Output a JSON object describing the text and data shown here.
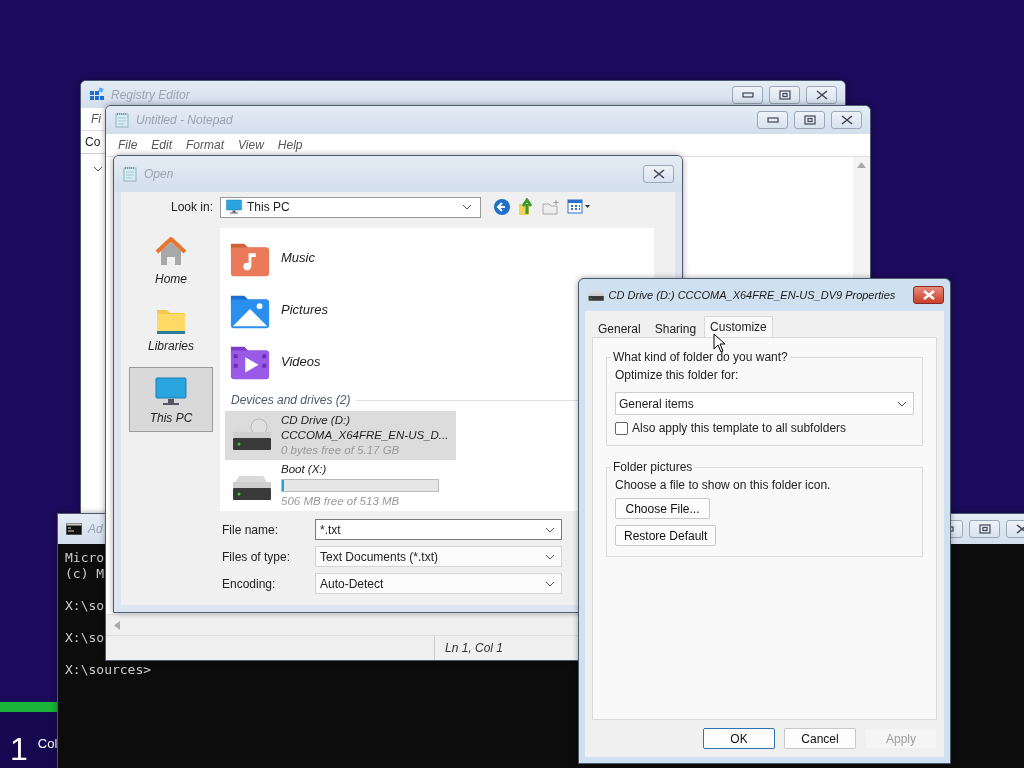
{
  "setup": {
    "step": "1",
    "label": "Col"
  },
  "registry_editor": {
    "title": "Registry Editor",
    "menu": [
      "Fi"
    ],
    "address": "Co"
  },
  "command_prompt": {
    "title": "Ad",
    "lines": [
      {
        "text": "Micro",
        "blank_before": false
      },
      {
        "text": "(c) M",
        "blank_before": false
      },
      {
        "text": "X:\\so",
        "blank_before": true
      },
      {
        "text": "X:\\so",
        "blank_before": true
      },
      {
        "text": "X:\\sources>",
        "blank_before": true
      }
    ]
  },
  "notepad": {
    "title": "Untitled - Notepad",
    "menu": [
      "File",
      "Edit",
      "Format",
      "View",
      "Help"
    ],
    "status": "Ln 1, Col 1"
  },
  "open_dialog": {
    "title": "Open",
    "look_in": {
      "label": "Look in:",
      "value": "This PC"
    },
    "places": [
      {
        "label": "Home",
        "kind": "home",
        "selected": false
      },
      {
        "label": "Libraries",
        "kind": "libraries",
        "selected": false
      },
      {
        "label": "This PC",
        "kind": "pc",
        "selected": true
      }
    ],
    "folders": [
      {
        "name": "Music",
        "kind": "music"
      },
      {
        "name": "Pictures",
        "kind": "pictures"
      },
      {
        "name": "Videos",
        "kind": "videos"
      }
    ],
    "group": "Devices and drives (2)",
    "drives": [
      {
        "name": "CD Drive (D:)",
        "kind": "cd",
        "volume": "CCCOMA_X64FRE_EN-US_D...",
        "free": "0 bytes free of 5.17 GB",
        "selected": true
      },
      {
        "name": "Boot (X:)",
        "kind": "disk",
        "level": 0.014,
        "free": "506 MB free of 513 MB",
        "selected": false
      }
    ],
    "fields": [
      {
        "label": "File name:",
        "value": "*.txt",
        "kind": "combo"
      },
      {
        "label": "Files of type:",
        "value": "Text Documents (*.txt)",
        "kind": "select"
      },
      {
        "label": "Encoding:",
        "value": "Auto-Detect",
        "kind": "select"
      }
    ]
  },
  "properties": {
    "title": "CD Drive (D:) CCCOMA_X64FRE_EN-US_DV9 Properties",
    "tabs": [
      {
        "label": "General",
        "selected": false
      },
      {
        "label": "Sharing",
        "selected": false
      },
      {
        "label": "Customize",
        "selected": true
      }
    ],
    "folder_type": {
      "title": "What kind of folder do you want?",
      "label": "Optimize this folder for:",
      "value": "General items",
      "checkbox": {
        "label": "Also apply this template to all subfolders",
        "checked": false
      }
    },
    "folder_pictures": {
      "title": "Folder pictures",
      "text": "Choose a file to show on this folder icon.",
      "buttons": [
        "Choose File...",
        "Restore Default"
      ]
    },
    "buttons": [
      {
        "label": "OK",
        "default": true,
        "disabled": false
      },
      {
        "label": "Cancel",
        "default": false,
        "disabled": false
      },
      {
        "label": "Apply",
        "default": false,
        "disabled": true
      }
    ]
  }
}
